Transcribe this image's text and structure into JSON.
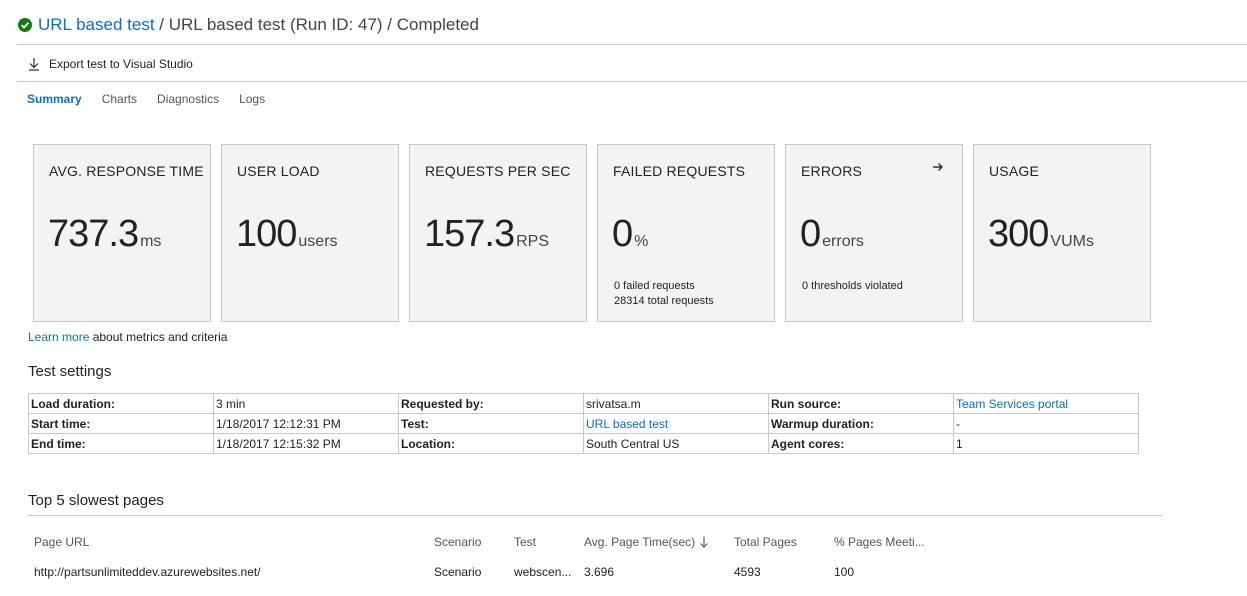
{
  "header": {
    "test_link": "URL based test",
    "rest": " / URL based test (Run ID: 47) / Completed"
  },
  "toolbar": {
    "export_label": "Export test to Visual Studio"
  },
  "tabs": [
    {
      "label": "Summary"
    },
    {
      "label": "Charts"
    },
    {
      "label": "Diagnostics"
    },
    {
      "label": "Logs"
    }
  ],
  "metrics": [
    {
      "label": "AVG. RESPONSE TIME",
      "value": "737.3",
      "unit": "ms"
    },
    {
      "label": "USER LOAD",
      "value": "100",
      "unit": "users"
    },
    {
      "label": "REQUESTS PER SEC",
      "value": "157.3",
      "unit": "RPS"
    },
    {
      "label": "FAILED REQUESTS",
      "value": "0",
      "unit": "%",
      "sub1": "0 failed requests",
      "sub2": "28314 total requests"
    },
    {
      "label": "ERRORS",
      "value": "0",
      "unit": "errors",
      "sub1": "0 thresholds violated"
    },
    {
      "label": "USAGE",
      "value": "300",
      "unit": "VUMs"
    }
  ],
  "learn": {
    "link": "Learn more",
    "text": " about metrics and criteria"
  },
  "settings": {
    "title": "Test settings",
    "rows": [
      [
        "Load duration:",
        "3 min",
        "Requested by:",
        "srivatsa.m",
        "Run source:",
        "Team Services portal"
      ],
      [
        "Start time:",
        "1/18/2017 12:12:31 PM",
        "Test:",
        "URL based test",
        "Warmup duration:",
        "-"
      ],
      [
        "End time:",
        "1/18/2017 12:15:32 PM",
        "Location:",
        "South Central US",
        "Agent cores:",
        "1"
      ]
    ]
  },
  "slowest": {
    "title": "Top 5 slowest pages",
    "columns": [
      "Page URL",
      "Scenario",
      "Test",
      "Avg. Page Time(sec)",
      "Total Pages",
      "% Pages Meeti..."
    ],
    "rows": [
      [
        "http://partsunlimiteddev.azurewebsites.net/",
        "Scenario",
        "webscen...",
        "3.696",
        "4593",
        "100"
      ]
    ]
  },
  "colors": {
    "accent": "#106ebe",
    "success": "#107c10",
    "card_bg": "#f3f3f3"
  }
}
